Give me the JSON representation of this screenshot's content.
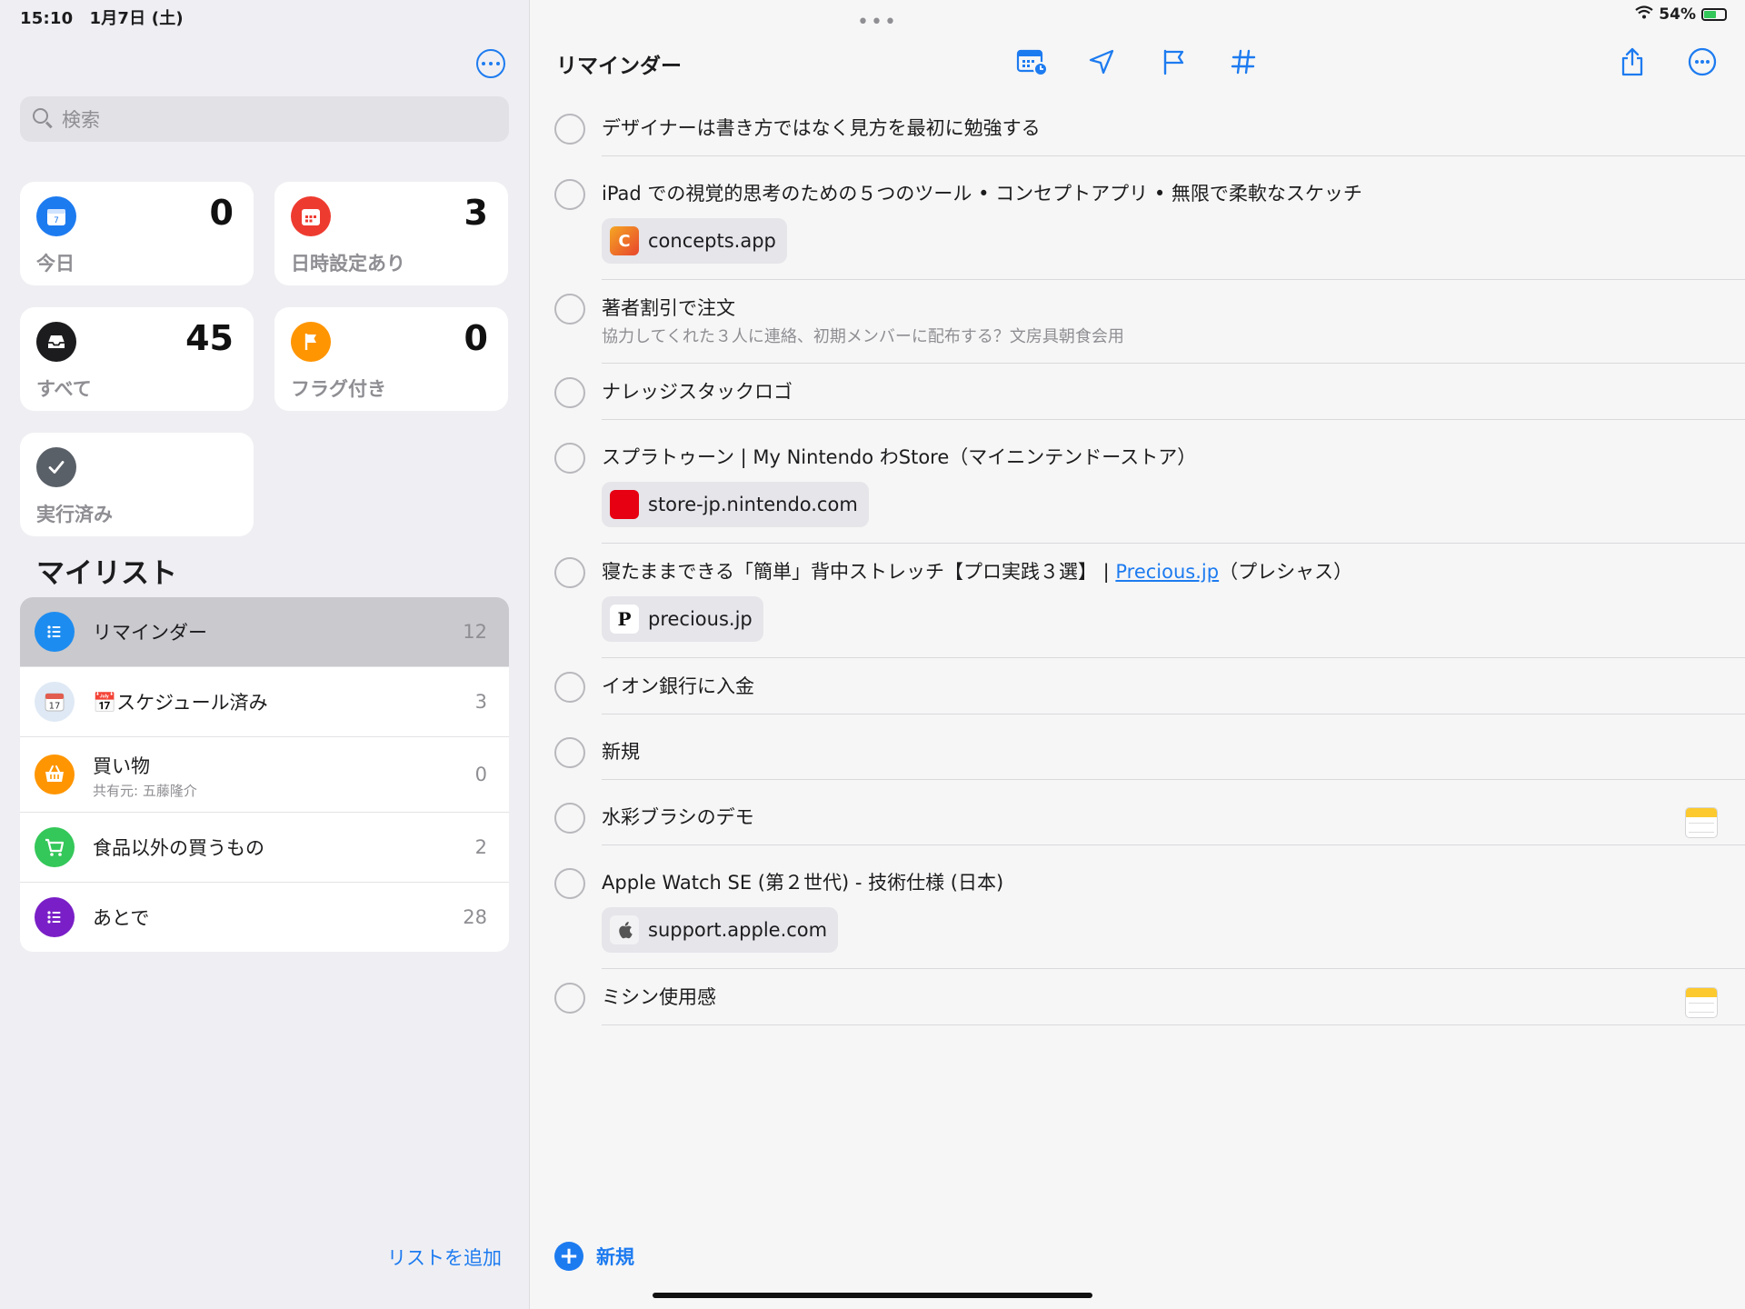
{
  "status": {
    "time": "15:10　1月7日 (土)",
    "battery": "54%"
  },
  "sidebar": {
    "search_placeholder": "検索",
    "cards": [
      {
        "label": "今日",
        "count": "0",
        "icon": "calendar-today-icon",
        "color": "#1d7bf0"
      },
      {
        "label": "日時設定あり",
        "count": "3",
        "icon": "calendar-icon",
        "color": "#ee3b30"
      },
      {
        "label": "すべて",
        "count": "45",
        "icon": "tray-icon",
        "color": "#1c1c1e"
      },
      {
        "label": "フラグ付き",
        "count": "0",
        "icon": "flag-icon",
        "color": "#ff9500"
      },
      {
        "label": "実行済み",
        "icon": "checkmark-icon",
        "color": "#5a6068"
      }
    ],
    "mylists_title": "マイリスト",
    "lists": [
      {
        "name": "リマインダー",
        "count": "12",
        "icon": "list-icon",
        "color": "#1d8cf0"
      },
      {
        "name": "📅スケジュール済み",
        "count": "3",
        "icon": "calendar-emoji-icon",
        "color": "#dfe9f5"
      },
      {
        "name": "買い物",
        "sub": "共有元: 五藤隆介",
        "count": "0",
        "icon": "basket-icon",
        "color": "#ff9500"
      },
      {
        "name": "食品以外の買うもの",
        "count": "2",
        "icon": "cart-icon",
        "color": "#34c759"
      },
      {
        "name": "あとで",
        "count": "28",
        "icon": "list-icon",
        "color": "#7a1fc7"
      }
    ],
    "add_list_label": "リストを追加"
  },
  "main": {
    "title": "リマインダー",
    "toolbar_icons": [
      "calendar-clock-icon",
      "location-icon",
      "flag-icon",
      "tag-icon",
      "share-icon",
      "more-icon"
    ],
    "items": [
      {
        "title": "デザイナーは書き方ではなく見方を最初に勉強する"
      },
      {
        "title": "iPad での視覚的思考のための５つのツール • コンセプトアプリ • 無限で柔軟なスケッチ",
        "chip": "concepts.app",
        "chip_icon": "concepts-icon"
      },
      {
        "title": "著者割引で注文",
        "note": "協力してくれた３人に連絡、初期メンバーに配布する？文房具朝食会用"
      },
      {
        "title": "ナレッジスタックロゴ"
      },
      {
        "title": "スプラトゥーン | My Nintendo わStore（マイニンテンドーストア）",
        "chip": "store-jp.nintendo.com",
        "chip_icon": "nintendo-icon"
      },
      {
        "title_before": "寝たままできる「簡単」背中ストレッチ【プロ実践３選】 | ",
        "title_link": "Precious.jp",
        "title_after": "（プレシャス）",
        "chip": "precious.jp",
        "chip_icon": "precious-icon"
      },
      {
        "title": "イオン銀行に入金"
      },
      {
        "title": "新規"
      },
      {
        "title": "水彩ブラシのデモ",
        "has_note_icon": true
      },
      {
        "title": "Apple Watch SE (第２世代) - 技術仕様 (日本)",
        "chip": "support.apple.com",
        "chip_icon": "apple-icon"
      },
      {
        "title": "ミシン使用感",
        "has_note_icon": true
      }
    ],
    "new_label": "新規"
  }
}
